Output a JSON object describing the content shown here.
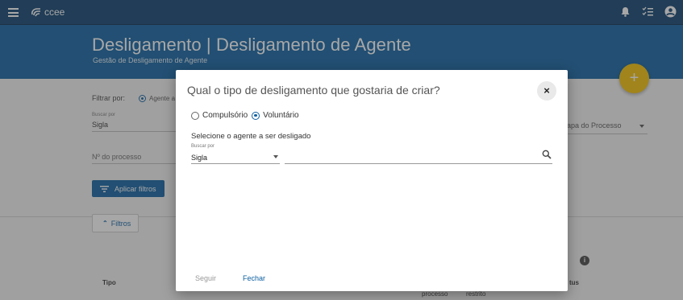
{
  "app": {
    "logo_text": "ccee"
  },
  "header": {
    "title": "Desligamento | Desligamento de Agente",
    "subtitle": "Gestão de Desligamento de Agente"
  },
  "background": {
    "filter_label": "Filtrar por:",
    "filter_option_partial": "Agente a",
    "buscar_por_label": "Buscar por",
    "buscar_por_value": "Sigla",
    "processo_placeholder": "Nº do processo",
    "etapa_placeholder": "apa do Processo",
    "apply_filters_label": "Aplicar filtros",
    "filters_toggle_label": "Filtros",
    "col_tipo": "Tipo",
    "col_processo": "processo",
    "col_restrito": "restrito",
    "col_status": "tus"
  },
  "modal": {
    "title": "Qual o tipo de desligamento que gostaria de criar?",
    "close_glyph": "×",
    "options": [
      {
        "label": "Compulsório",
        "checked": false
      },
      {
        "label": "Voluntário",
        "checked": true
      }
    ],
    "agent_prompt": "Selecione o agente a ser desligado",
    "buscar_por_label": "Buscar por",
    "buscar_por_value": "Sigla",
    "search_value": "",
    "next_label": "Seguir",
    "close_label": "Fechar"
  },
  "icons": {
    "menu": "hamburger-menu-icon",
    "notifications": "bell-icon",
    "tasks": "checklist-icon",
    "account": "account-circle-icon",
    "add": "plus-icon",
    "search": "magnifier-icon",
    "info": "info-icon"
  },
  "colors": {
    "topbar": "#0b3e6e",
    "banner": "#0d5fa0",
    "fab": "#f5c000",
    "primary": "#0d5fa0"
  }
}
